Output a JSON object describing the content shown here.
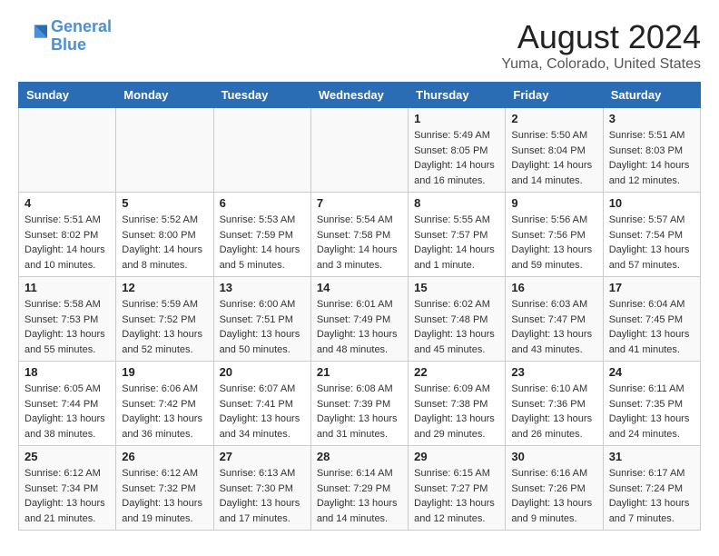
{
  "logo": {
    "line1": "General",
    "line2": "Blue"
  },
  "title": "August 2024",
  "subtitle": "Yuma, Colorado, United States",
  "days_of_week": [
    "Sunday",
    "Monday",
    "Tuesday",
    "Wednesday",
    "Thursday",
    "Friday",
    "Saturday"
  ],
  "weeks": [
    [
      {
        "day": "",
        "info": ""
      },
      {
        "day": "",
        "info": ""
      },
      {
        "day": "",
        "info": ""
      },
      {
        "day": "",
        "info": ""
      },
      {
        "day": "1",
        "info": "Sunrise: 5:49 AM\nSunset: 8:05 PM\nDaylight: 14 hours\nand 16 minutes."
      },
      {
        "day": "2",
        "info": "Sunrise: 5:50 AM\nSunset: 8:04 PM\nDaylight: 14 hours\nand 14 minutes."
      },
      {
        "day": "3",
        "info": "Sunrise: 5:51 AM\nSunset: 8:03 PM\nDaylight: 14 hours\nand 12 minutes."
      }
    ],
    [
      {
        "day": "4",
        "info": "Sunrise: 5:51 AM\nSunset: 8:02 PM\nDaylight: 14 hours\nand 10 minutes."
      },
      {
        "day": "5",
        "info": "Sunrise: 5:52 AM\nSunset: 8:00 PM\nDaylight: 14 hours\nand 8 minutes."
      },
      {
        "day": "6",
        "info": "Sunrise: 5:53 AM\nSunset: 7:59 PM\nDaylight: 14 hours\nand 5 minutes."
      },
      {
        "day": "7",
        "info": "Sunrise: 5:54 AM\nSunset: 7:58 PM\nDaylight: 14 hours\nand 3 minutes."
      },
      {
        "day": "8",
        "info": "Sunrise: 5:55 AM\nSunset: 7:57 PM\nDaylight: 14 hours\nand 1 minute."
      },
      {
        "day": "9",
        "info": "Sunrise: 5:56 AM\nSunset: 7:56 PM\nDaylight: 13 hours\nand 59 minutes."
      },
      {
        "day": "10",
        "info": "Sunrise: 5:57 AM\nSunset: 7:54 PM\nDaylight: 13 hours\nand 57 minutes."
      }
    ],
    [
      {
        "day": "11",
        "info": "Sunrise: 5:58 AM\nSunset: 7:53 PM\nDaylight: 13 hours\nand 55 minutes."
      },
      {
        "day": "12",
        "info": "Sunrise: 5:59 AM\nSunset: 7:52 PM\nDaylight: 13 hours\nand 52 minutes."
      },
      {
        "day": "13",
        "info": "Sunrise: 6:00 AM\nSunset: 7:51 PM\nDaylight: 13 hours\nand 50 minutes."
      },
      {
        "day": "14",
        "info": "Sunrise: 6:01 AM\nSunset: 7:49 PM\nDaylight: 13 hours\nand 48 minutes."
      },
      {
        "day": "15",
        "info": "Sunrise: 6:02 AM\nSunset: 7:48 PM\nDaylight: 13 hours\nand 45 minutes."
      },
      {
        "day": "16",
        "info": "Sunrise: 6:03 AM\nSunset: 7:47 PM\nDaylight: 13 hours\nand 43 minutes."
      },
      {
        "day": "17",
        "info": "Sunrise: 6:04 AM\nSunset: 7:45 PM\nDaylight: 13 hours\nand 41 minutes."
      }
    ],
    [
      {
        "day": "18",
        "info": "Sunrise: 6:05 AM\nSunset: 7:44 PM\nDaylight: 13 hours\nand 38 minutes."
      },
      {
        "day": "19",
        "info": "Sunrise: 6:06 AM\nSunset: 7:42 PM\nDaylight: 13 hours\nand 36 minutes."
      },
      {
        "day": "20",
        "info": "Sunrise: 6:07 AM\nSunset: 7:41 PM\nDaylight: 13 hours\nand 34 minutes."
      },
      {
        "day": "21",
        "info": "Sunrise: 6:08 AM\nSunset: 7:39 PM\nDaylight: 13 hours\nand 31 minutes."
      },
      {
        "day": "22",
        "info": "Sunrise: 6:09 AM\nSunset: 7:38 PM\nDaylight: 13 hours\nand 29 minutes."
      },
      {
        "day": "23",
        "info": "Sunrise: 6:10 AM\nSunset: 7:36 PM\nDaylight: 13 hours\nand 26 minutes."
      },
      {
        "day": "24",
        "info": "Sunrise: 6:11 AM\nSunset: 7:35 PM\nDaylight: 13 hours\nand 24 minutes."
      }
    ],
    [
      {
        "day": "25",
        "info": "Sunrise: 6:12 AM\nSunset: 7:34 PM\nDaylight: 13 hours\nand 21 minutes."
      },
      {
        "day": "26",
        "info": "Sunrise: 6:12 AM\nSunset: 7:32 PM\nDaylight: 13 hours\nand 19 minutes."
      },
      {
        "day": "27",
        "info": "Sunrise: 6:13 AM\nSunset: 7:30 PM\nDaylight: 13 hours\nand 17 minutes."
      },
      {
        "day": "28",
        "info": "Sunrise: 6:14 AM\nSunset: 7:29 PM\nDaylight: 13 hours\nand 14 minutes."
      },
      {
        "day": "29",
        "info": "Sunrise: 6:15 AM\nSunset: 7:27 PM\nDaylight: 13 hours\nand 12 minutes."
      },
      {
        "day": "30",
        "info": "Sunrise: 6:16 AM\nSunset: 7:26 PM\nDaylight: 13 hours\nand 9 minutes."
      },
      {
        "day": "31",
        "info": "Sunrise: 6:17 AM\nSunset: 7:24 PM\nDaylight: 13 hours\nand 7 minutes."
      }
    ]
  ]
}
